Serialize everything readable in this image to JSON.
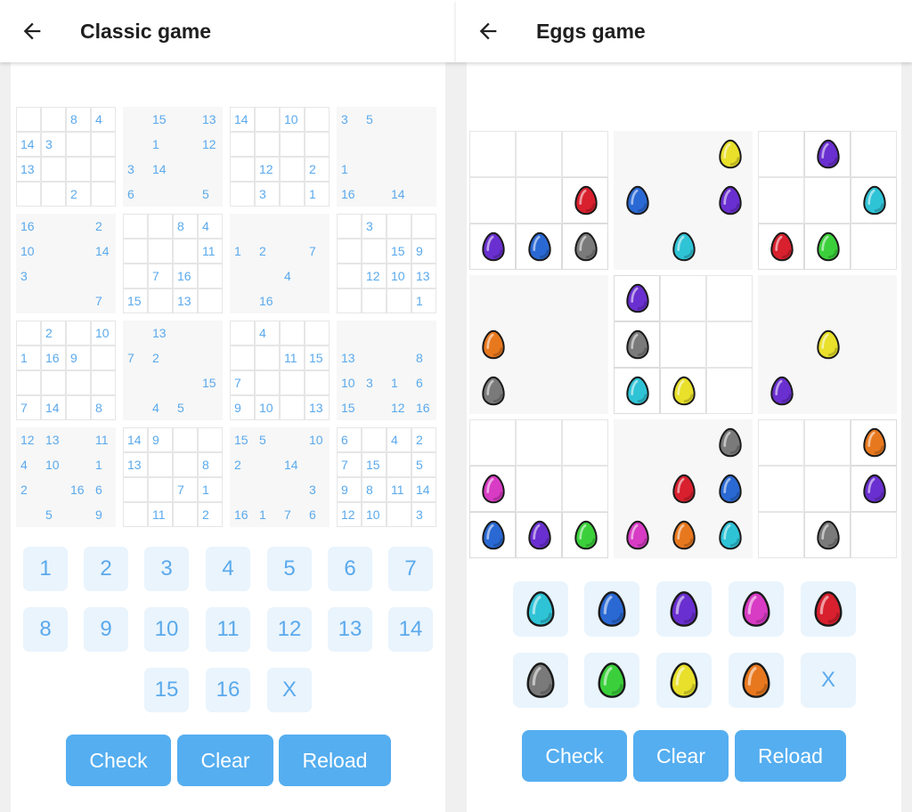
{
  "left": {
    "title": "Classic game",
    "rows": [
      [
        "",
        "",
        "8",
        "4",
        "",
        "15",
        "",
        "13",
        "14",
        "",
        "10",
        "",
        "3",
        "5",
        "",
        ""
      ],
      [
        "14",
        "3",
        "",
        "",
        "",
        "1",
        "",
        "12",
        "",
        "",
        "",
        "",
        "",
        "",
        "",
        ""
      ],
      [
        "13",
        "",
        "",
        "",
        "3",
        "14",
        "",
        "",
        "",
        "12",
        "",
        "2",
        "1",
        "",
        "",
        ""
      ],
      [
        "",
        "",
        "2",
        "",
        "6",
        "",
        "",
        "5",
        "",
        "3",
        "",
        "1",
        "16",
        "",
        "14",
        ""
      ],
      [
        "16",
        "",
        "",
        "2",
        "",
        "",
        "8",
        "4",
        "",
        "",
        "",
        "",
        "",
        "3",
        "",
        ""
      ],
      [
        "10",
        "",
        "",
        "14",
        "",
        "",
        "",
        "11",
        "1",
        "2",
        "",
        "7",
        "",
        "",
        "15",
        "9"
      ],
      [
        "3",
        "",
        "",
        "",
        "",
        "7",
        "16",
        "",
        "",
        "",
        "4",
        "",
        "",
        "12",
        "10",
        "13"
      ],
      [
        "",
        "",
        "",
        "7",
        "15",
        "",
        "13",
        "",
        "",
        "16",
        "",
        "",
        "",
        "",
        "",
        "1"
      ],
      [
        "",
        "2",
        "",
        "10",
        "",
        "13",
        "",
        "",
        "",
        "4",
        "",
        "",
        "",
        "",
        "",
        ""
      ],
      [
        "1",
        "16",
        "9",
        "",
        "7",
        "2",
        "",
        "",
        "",
        "",
        "11",
        "15",
        "13",
        "",
        "",
        "8"
      ],
      [
        "",
        "",
        "",
        "",
        "",
        "",
        "",
        "15",
        "7",
        "",
        "",
        "",
        "10",
        "3",
        "1",
        "6"
      ],
      [
        "7",
        "14",
        "",
        "8",
        "",
        "4",
        "5",
        "",
        "9",
        "10",
        "",
        "13",
        "15",
        "",
        "12",
        "16"
      ],
      [
        "12",
        "13",
        "",
        "11",
        "14",
        "9",
        "",
        "",
        "15",
        "5",
        "",
        "10",
        "6",
        "",
        "4",
        "2"
      ],
      [
        "4",
        "10",
        "",
        "1",
        "13",
        "",
        "",
        "8",
        "2",
        "",
        "14",
        "",
        "7",
        "15",
        "",
        "5"
      ],
      [
        "2",
        "",
        "16",
        "6",
        "",
        "",
        "7",
        "1",
        "",
        "",
        "",
        "3",
        "9",
        "8",
        "11",
        "14"
      ],
      [
        "",
        "5",
        "",
        "9",
        "",
        "11",
        "",
        "2",
        "16",
        "1",
        "7",
        "6",
        "12",
        "10",
        "",
        "3"
      ]
    ],
    "numbers": [
      "1",
      "2",
      "3",
      "4",
      "5",
      "6",
      "7",
      "8",
      "9",
      "10",
      "11",
      "12",
      "13",
      "14",
      "15",
      "16",
      "X"
    ],
    "buttons": {
      "check": "Check",
      "clear": "Clear",
      "reload": "Reload"
    }
  },
  "right": {
    "title": "Eggs game",
    "rows": [
      [
        "",
        "",
        "",
        "",
        "",
        "yellow",
        "",
        "purple",
        ""
      ],
      [
        "",
        "",
        "red",
        "blue",
        "",
        "purple",
        "",
        "",
        "cyan"
      ],
      [
        "purple",
        "blue",
        "gray",
        "",
        "cyan",
        "",
        "red",
        "green",
        ""
      ],
      [
        "",
        "",
        "",
        "purple",
        "",
        "",
        "",
        "",
        ""
      ],
      [
        "orange",
        "",
        "",
        "gray",
        "",
        "",
        "",
        "yellow",
        ""
      ],
      [
        "gray",
        "",
        "",
        "cyan",
        "yellow",
        "",
        "purple",
        "",
        ""
      ],
      [
        "",
        "",
        "",
        "",
        "",
        "gray",
        "",
        "",
        "orange"
      ],
      [
        "magenta",
        "",
        "",
        "",
        "red",
        "blue",
        "",
        "",
        "purple"
      ],
      [
        "blue",
        "purple",
        "green",
        "magenta",
        "orange",
        "cyan",
        "",
        "gray",
        ""
      ]
    ],
    "palette": [
      "cyan",
      "blue",
      "purple",
      "magenta",
      "red",
      "gray",
      "green",
      "yellow",
      "orange"
    ],
    "clear_symbol": "X",
    "buttons": {
      "check": "Check",
      "clear": "Clear",
      "reload": "Reload"
    },
    "colors": {
      "cyan": "#2fc3d6",
      "blue": "#2a69d4",
      "purple": "#6a2fd0",
      "magenta": "#d83bc4",
      "red": "#d8202e",
      "gray": "#7a7a7a",
      "green": "#3bd03b",
      "yellow": "#e8e02a",
      "orange": "#e8781e"
    }
  }
}
